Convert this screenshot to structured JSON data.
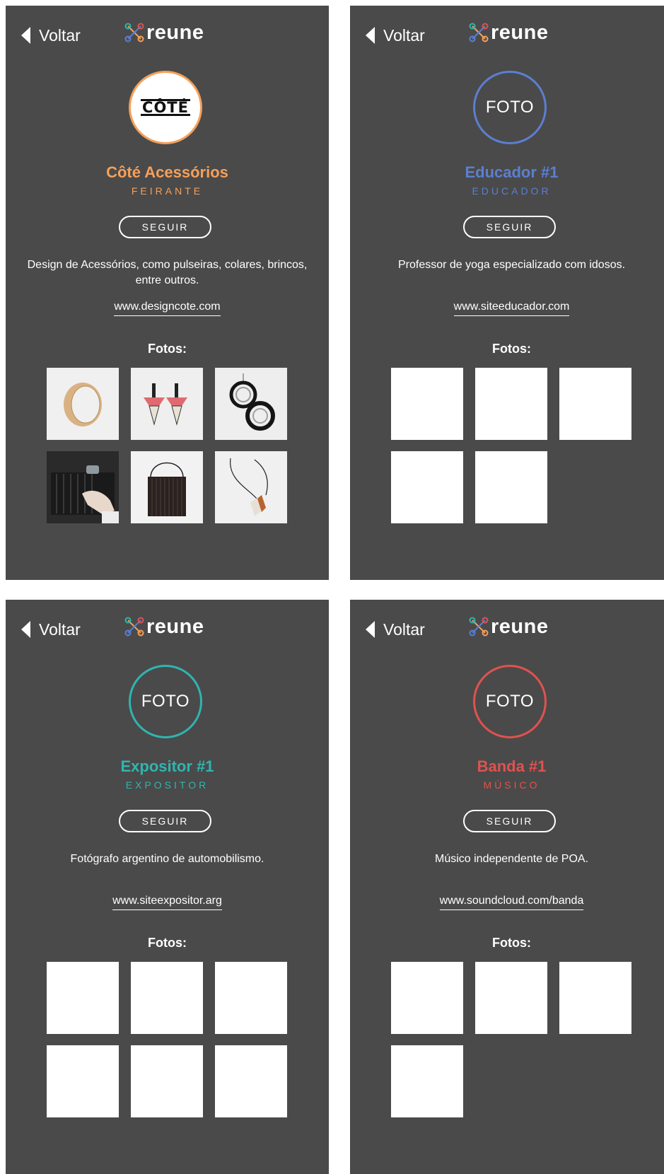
{
  "common": {
    "back_label": "Voltar",
    "logo_text": "reune",
    "follow_label": "SEGUIR",
    "photos_title": "Fotos:"
  },
  "profiles": [
    {
      "avatar_text": "CÔTÉ",
      "name": "Côté Acessórios",
      "role": "FEIRANTE",
      "color": "#f5a05a",
      "description": "Design de Acessórios, como pulseiras, colares, brincos, entre outros.",
      "website": "www.designcote.com",
      "photo_count": 6
    },
    {
      "avatar_text": "FOTO",
      "name": "Educador #1",
      "role": "EDUCADOR",
      "color": "#5b7fd0",
      "description": "Professor de yoga especializado com idosos.",
      "website": "www.siteeducador.com",
      "photo_count": 5
    },
    {
      "avatar_text": "FOTO",
      "name": "Expositor #1",
      "role": "EXPOSITOR",
      "color": "#2fb5b0",
      "description": "Fotógrafo argentino de automobilismo.",
      "website": "www.siteexpositor.arg",
      "photo_count": 6
    },
    {
      "avatar_text": "FOTO",
      "name": "Banda #1",
      "role": "MÚSICO",
      "color": "#e0524f",
      "description": "Músico independente de POA.",
      "website": "www.soundcloud.com/banda",
      "photo_count": 4
    }
  ],
  "logo_colors": [
    "#f5a05a",
    "#5b7fd0",
    "#2fb5b0",
    "#e0524f"
  ]
}
